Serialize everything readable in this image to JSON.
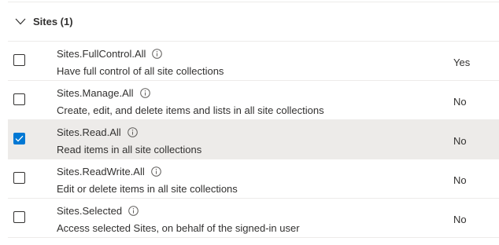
{
  "group": {
    "title": "Sites (1)",
    "expanded": true
  },
  "permissions": [
    {
      "name": "Sites.FullControl.All",
      "description": "Have full control of all site collections",
      "admin_consent": "Yes",
      "checked": false
    },
    {
      "name": "Sites.Manage.All",
      "description": "Create, edit, and delete items and lists in all site collections",
      "admin_consent": "No",
      "checked": false
    },
    {
      "name": "Sites.Read.All",
      "description": "Read items in all site collections",
      "admin_consent": "No",
      "checked": true
    },
    {
      "name": "Sites.ReadWrite.All",
      "description": "Edit or delete items in all site collections",
      "admin_consent": "No",
      "checked": false
    },
    {
      "name": "Sites.Selected",
      "description": "Access selected Sites, on behalf of the signed-in user",
      "admin_consent": "No",
      "checked": false
    }
  ],
  "colors": {
    "accent": "#0078d4",
    "selected_row": "#edebe9",
    "divider": "#edebe9",
    "text": "#323130"
  },
  "icons": {
    "chevron": "chevron-down-icon",
    "info": "info-icon",
    "check": "checkmark-icon"
  }
}
